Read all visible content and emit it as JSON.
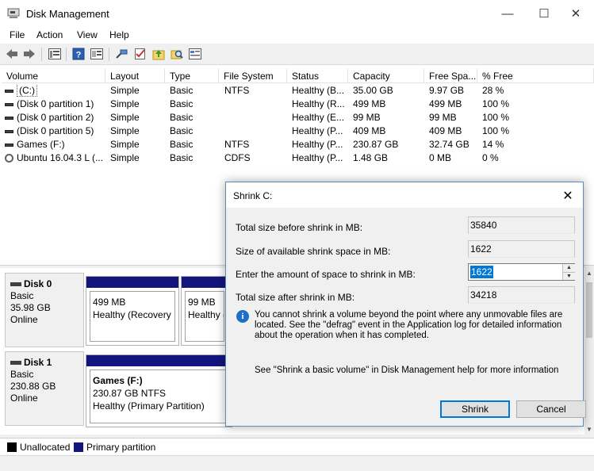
{
  "window": {
    "title": "Disk Management"
  },
  "menu": [
    "File",
    "Action",
    "View",
    "Help"
  ],
  "toolbar_icons": [
    "back-arrow-icon",
    "forward-arrow-icon",
    "list-view-icon",
    "help-book-icon",
    "properties-icon",
    "connect-icon",
    "check-icon",
    "folder-up-icon",
    "search-folder-icon",
    "console-icon"
  ],
  "volumes": {
    "columns": [
      "Volume",
      "Layout",
      "Type",
      "File System",
      "Status",
      "Capacity",
      "Free Spa...",
      "% Free"
    ],
    "rows": [
      [
        "(C:)",
        "Simple",
        "Basic",
        "NTFS",
        "Healthy (B...",
        "35.00 GB",
        "9.97 GB",
        "28 %"
      ],
      [
        "(Disk 0 partition 1)",
        "Simple",
        "Basic",
        "",
        "Healthy (R...",
        "499 MB",
        "499 MB",
        "100 %"
      ],
      [
        "(Disk 0 partition 2)",
        "Simple",
        "Basic",
        "",
        "Healthy (E...",
        "99 MB",
        "99 MB",
        "100 %"
      ],
      [
        "(Disk 0 partition 5)",
        "Simple",
        "Basic",
        "",
        "Healthy (P...",
        "409 MB",
        "409 MB",
        "100 %"
      ],
      [
        "Games (F:)",
        "Simple",
        "Basic",
        "NTFS",
        "Healthy (P...",
        "230.87 GB",
        "32.74 GB",
        "14 %"
      ],
      [
        "Ubuntu 16.04.3 L (...",
        "Simple",
        "Basic",
        "CDFS",
        "Healthy (P...",
        "1.48 GB",
        "0 MB",
        "0 %"
      ]
    ]
  },
  "disks": [
    {
      "name": "Disk 0",
      "type": "Basic",
      "size": "35.98 GB",
      "state": "Online",
      "partitions": [
        {
          "size": "499 MB",
          "status": "Healthy (Recovery P"
        },
        {
          "size": "99 MB",
          "status": "Healthy ("
        }
      ]
    },
    {
      "name": "Disk 1",
      "type": "Basic",
      "size": "230.88 GB",
      "state": "Online",
      "partitions": [
        {
          "name": "Games  (F:)",
          "size": "230.87 GB NTFS",
          "status": "Healthy (Primary Partition)"
        }
      ]
    }
  ],
  "legend": [
    {
      "label": "Unallocated",
      "color": "#000000"
    },
    {
      "label": "Primary partition",
      "color": "#13157f"
    }
  ],
  "dialog": {
    "title": "Shrink C:",
    "total_before_label": "Total size before shrink in MB:",
    "total_before_value": "35840",
    "available_label": "Size of available shrink space in MB:",
    "available_value": "1622",
    "amount_label": "Enter the amount of space to shrink in MB:",
    "amount_value": "1622",
    "after_label": "Total size after shrink in MB:",
    "after_value": "34218",
    "info": "You cannot shrink a volume beyond the point where any unmovable files are located. See the \"defrag\" event in the Application log for detailed information about the operation when it has completed.",
    "help": "See \"Shrink a basic volume\" in Disk Management help for more information",
    "shrink_button": "Shrink",
    "cancel_button": "Cancel"
  }
}
